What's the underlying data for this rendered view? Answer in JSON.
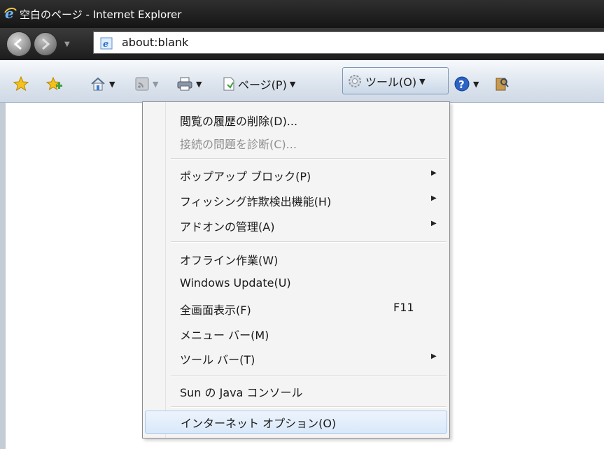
{
  "window": {
    "title": "空白のページ - Internet Explorer"
  },
  "address_bar": {
    "url": "about:blank"
  },
  "command_bar": {
    "page_label": "ページ(P)",
    "tools_label": "ツール(O)"
  },
  "tools_menu": {
    "items": [
      {
        "label": "閲覧の履歴の削除(D)..."
      },
      {
        "label": "接続の問題を診断(C)..."
      },
      {
        "label": "ポップアップ ブロック(P)"
      },
      {
        "label": "フィッシング詐欺検出機能(H)"
      },
      {
        "label": "アドオンの管理(A)"
      },
      {
        "label": "オフライン作業(W)"
      },
      {
        "label": "Windows Update(U)"
      },
      {
        "label": "全画面表示(F)",
        "shortcut": "F11"
      },
      {
        "label": "メニュー バー(M)"
      },
      {
        "label": "ツール バー(T)"
      },
      {
        "label": "Sun の Java コンソール"
      },
      {
        "label": "インターネット オプション(O)"
      }
    ]
  },
  "colors": {
    "title_bar": "#1e1e1e",
    "command_bar": "#dde5ee",
    "menu_background": "#f4f4f4",
    "menu_highlight": "#d9e8fa"
  },
  "icons": [
    "ie-logo-icon",
    "back-icon",
    "forward-icon",
    "page-icon",
    "favorites-star-icon",
    "add-favorites-icon",
    "home-icon",
    "feeds-icon",
    "print-icon",
    "page-menu-icon",
    "gear-icon",
    "help-icon",
    "research-icon",
    "submenu-arrow-icon"
  ]
}
